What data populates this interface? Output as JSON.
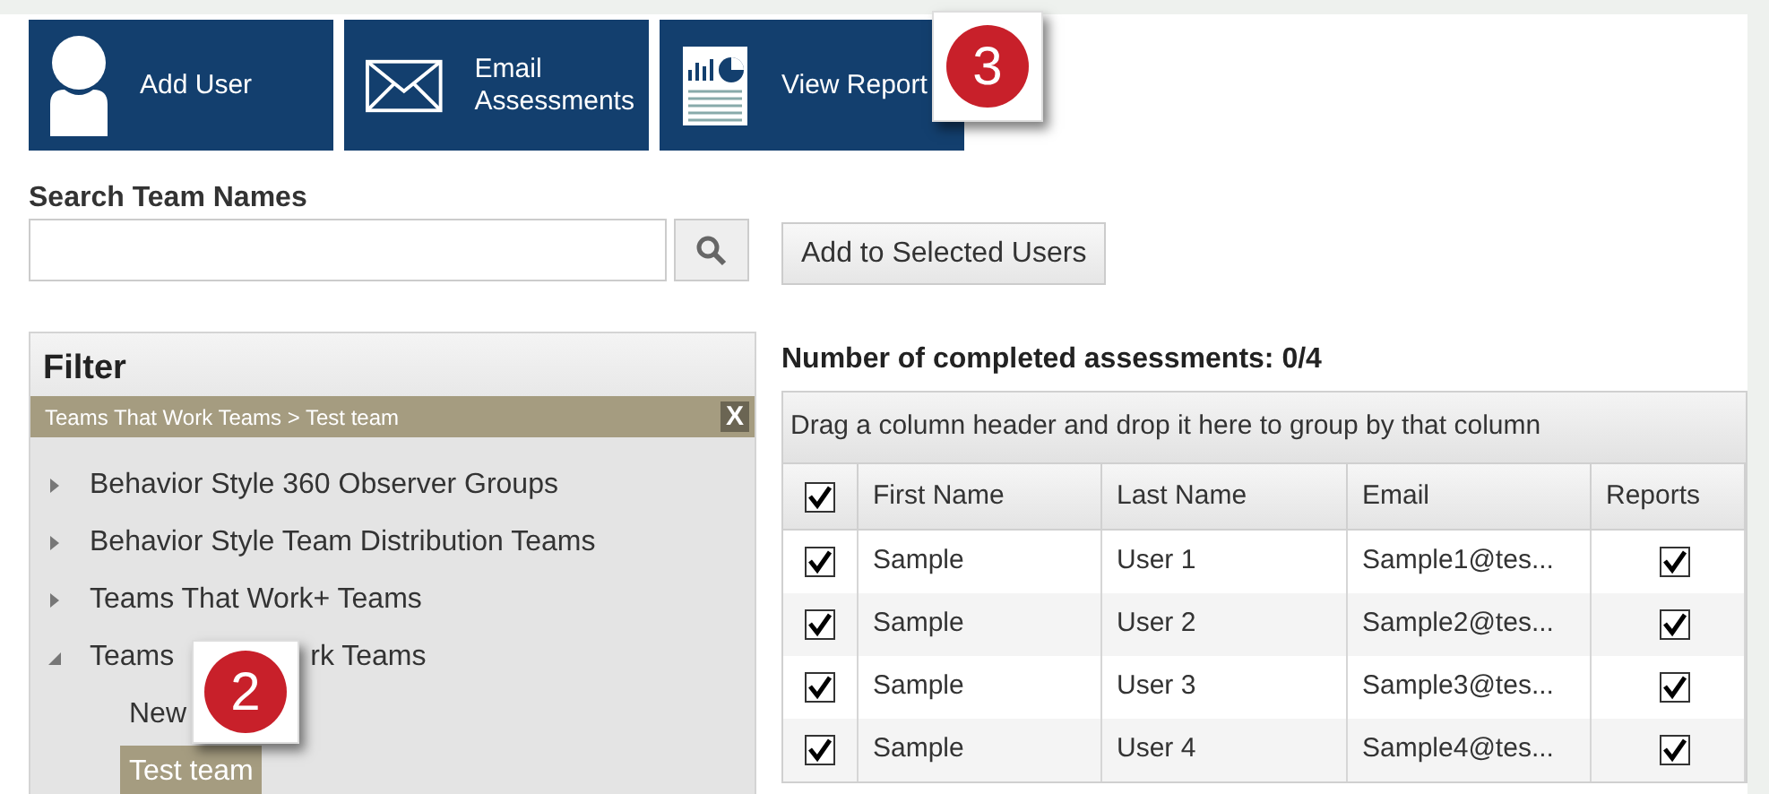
{
  "toolbar": [
    {
      "kind": "user",
      "label": "Add User"
    },
    {
      "kind": "email",
      "label": "Email Assessments"
    },
    {
      "kind": "report",
      "label": "View Report"
    }
  ],
  "callouts": [
    "3",
    "2"
  ],
  "search": {
    "label": "Search Team Names"
  },
  "add_button": "Add to Selected Users",
  "filter": {
    "title": "Filter",
    "breadcrumb": "Teams That Work Teams > Test team",
    "clear": "X",
    "tree": [
      {
        "label_parts": [
          "Behavior Style 360 Observer Groups"
        ],
        "expanded": false
      },
      {
        "label_parts": [
          "Behavior Style Team Distribution Teams"
        ],
        "expanded": false
      },
      {
        "label_parts": [
          "Teams That Work+ Teams"
        ],
        "expanded": false
      },
      {
        "label_parts": [
          "Teams",
          "rk Teams"
        ],
        "expanded": true,
        "children": [
          {
            "label": "New",
            "selected": false
          },
          {
            "label": "Test team",
            "selected": true
          }
        ]
      }
    ]
  },
  "summary": "Number of completed assessments: 0/4",
  "grid": {
    "group_hint": "Drag a column header and drop it here to group by that column",
    "select_all": true,
    "columns": [
      "First Name",
      "Last Name",
      "Email",
      "Reports"
    ],
    "rows": [
      {
        "checked": true,
        "first": "Sample",
        "last": "User 1",
        "email": "Sample1@tes...",
        "reports": true
      },
      {
        "checked": true,
        "first": "Sample",
        "last": "User 2",
        "email": "Sample2@tes...",
        "reports": true
      },
      {
        "checked": true,
        "first": "Sample",
        "last": "User 3",
        "email": "Sample3@tes...",
        "reports": true
      },
      {
        "checked": true,
        "first": "Sample",
        "last": "User 4",
        "email": "Sample4@tes...",
        "reports": true
      }
    ]
  }
}
